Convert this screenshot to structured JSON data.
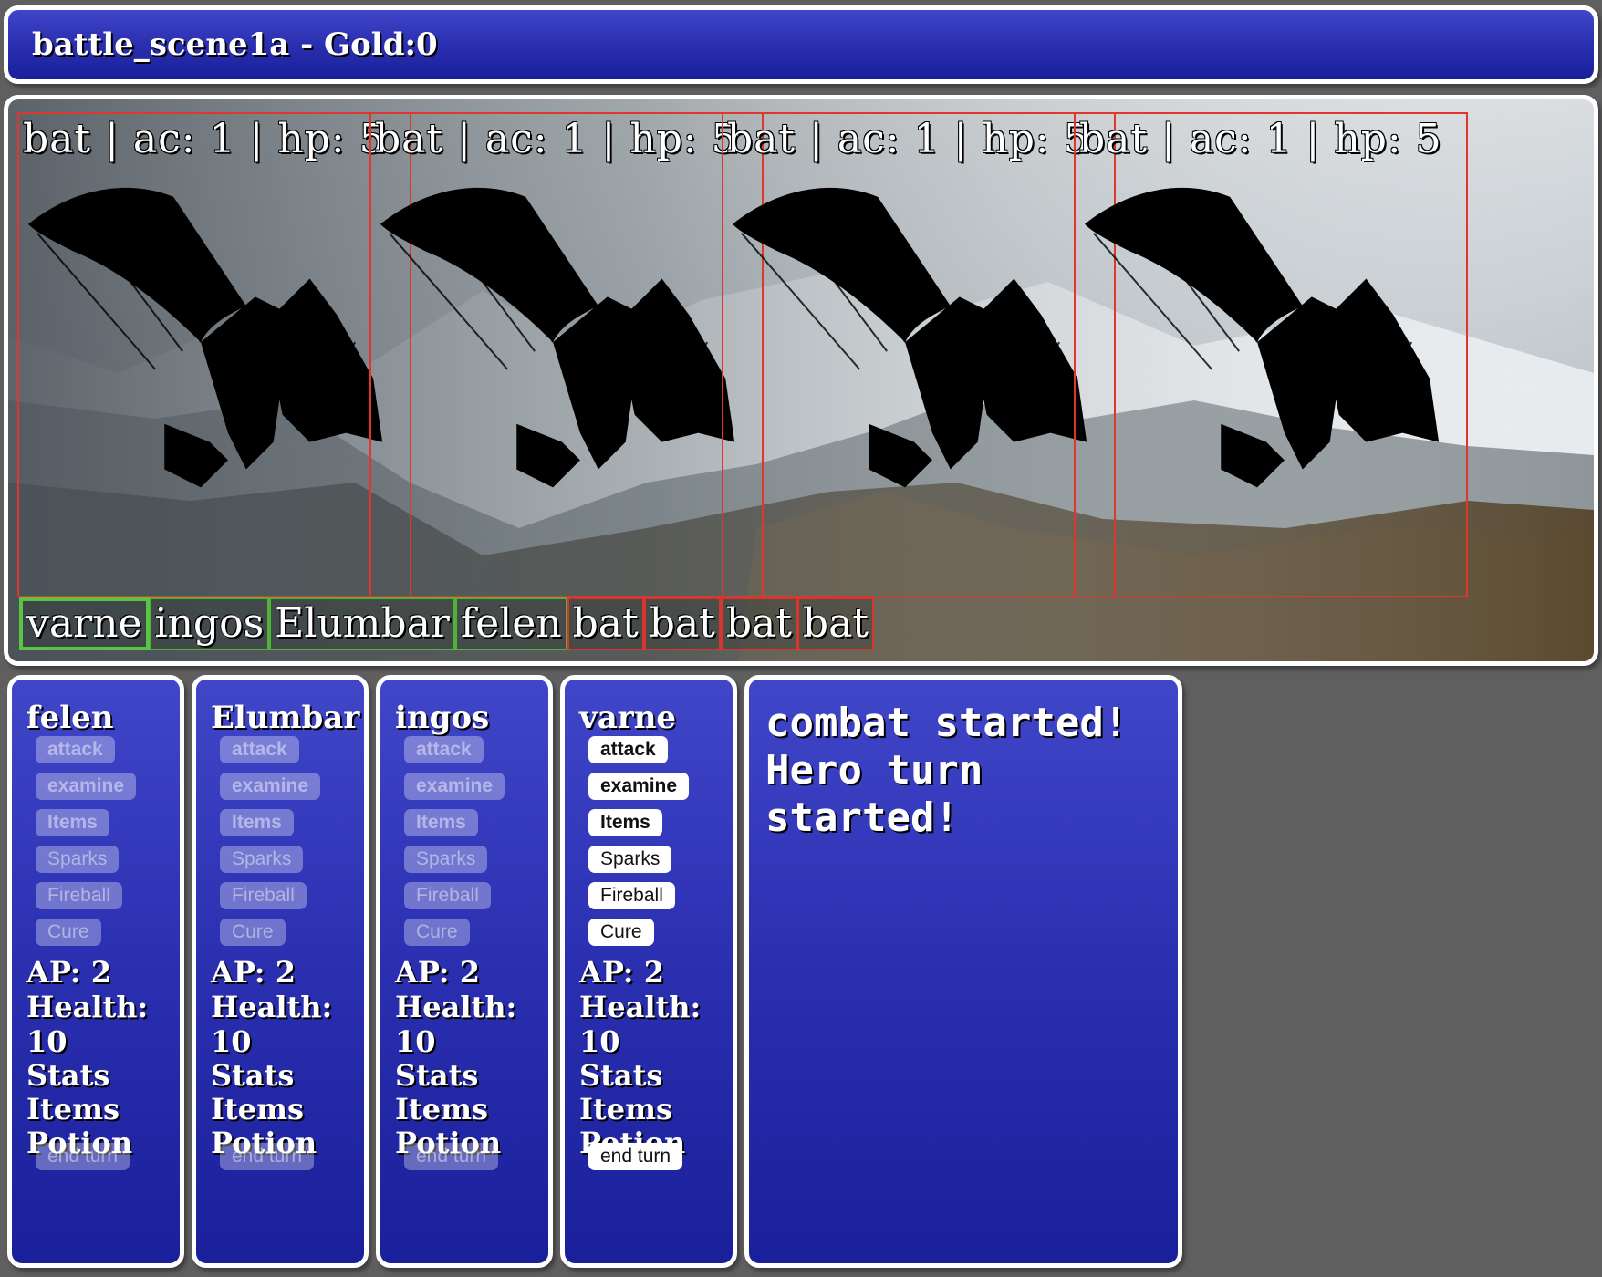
{
  "titlebar": {
    "title": "battle_scene1a - Gold:0"
  },
  "enemies": [
    {
      "label": "bat | ac: 1 | hp: 5"
    },
    {
      "label": "bat | ac: 1 | hp: 5"
    },
    {
      "label": "bat | ac: 1 | hp: 5"
    },
    {
      "label": "bat | ac: 1 | hp: 5"
    }
  ],
  "turn_order": [
    "varne",
    "ingos",
    "Elumbar",
    "felen",
    "bat",
    "bat",
    "bat",
    "bat"
  ],
  "heroes": [
    {
      "name": "felen",
      "actions": [
        "attack",
        "examine",
        "Items",
        "Sparks",
        "Fireball",
        "Cure"
      ],
      "ap": "AP: 2",
      "health": "Health: 10",
      "stats": "Stats",
      "items": "Items",
      "potion": "Potion",
      "end_turn": "end turn",
      "active": false
    },
    {
      "name": "Elumbar",
      "actions": [
        "attack",
        "examine",
        "Items",
        "Sparks",
        "Fireball",
        "Cure"
      ],
      "ap": "AP: 2",
      "health": "Health: 10",
      "stats": "Stats",
      "items": "Items",
      "potion": "Potion",
      "end_turn": "end turn",
      "active": false
    },
    {
      "name": "ingos",
      "actions": [
        "attack",
        "examine",
        "Items",
        "Sparks",
        "Fireball",
        "Cure"
      ],
      "ap": "AP: 2",
      "health": "Health: 10",
      "stats": "Stats",
      "items": "Items",
      "potion": "Potion",
      "end_turn": "end turn",
      "active": false
    },
    {
      "name": "varne",
      "actions": [
        "attack",
        "examine",
        "Items",
        "Sparks",
        "Fireball",
        "Cure"
      ],
      "ap": "AP: 2",
      "health": "Health: 10",
      "stats": "Stats",
      "items": "Items",
      "potion": "Potion",
      "end_turn": "end turn",
      "active": true
    }
  ],
  "log": {
    "line1": "combat started!",
    "line2": "Hero turn started!"
  },
  "colors": {
    "panel_blue": "#3038b8",
    "enemy_border": "#e0362c",
    "hero_border": "#5ac443",
    "background": "#5f5f5f"
  }
}
